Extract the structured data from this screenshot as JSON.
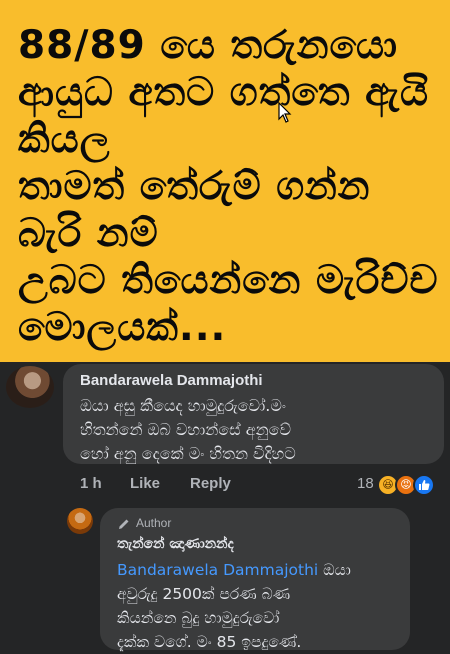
{
  "post": {
    "lines": [
      "88/89 යෙ තරුනයො",
      "ආයුධ අතට ගත්තෙ ඇයි",
      "කියල",
      "තාමත් තේරුම් ගන්න",
      "බැරි නම්",
      "උබට තියෙන්නෙ මැරිච්ච",
      "මොලයක්..."
    ]
  },
  "comment": {
    "author": "Bandarawela Dammajothi",
    "text_lines": [
      "ඔයා අසු කීයෙද හාමුදුරුවෝ.මං",
      "හිතන්නේ ඔබ වහාන්සේ අනුවේ",
      "හෝ අනු දෙකේ මං හිතන විදිහට"
    ],
    "time": "1 h",
    "like_label": "Like",
    "reply_label": "Reply",
    "reaction_count": "18",
    "reaction_icons": [
      "haha-icon",
      "angry-icon",
      "like-icon"
    ]
  },
  "reply": {
    "badge": "Author",
    "author": "තැන්නේ ඤාණානන්ද",
    "mention": "Bandarawela Dammajothi",
    "text_first": " ඔයා",
    "text_lines": [
      "අවුරුදු 2500ක් පරණ බණ",
      "කියන්නෙ බුදු හාමුදුරුවෝ",
      "දැක්ක වගේ.  මං 85 ඉපදුණේ."
    ]
  },
  "colors": {
    "post_background": "#f9bd2c",
    "comment_bubble": "#3a3b3c",
    "page_background": "#242526",
    "mention": "#4599ff"
  }
}
